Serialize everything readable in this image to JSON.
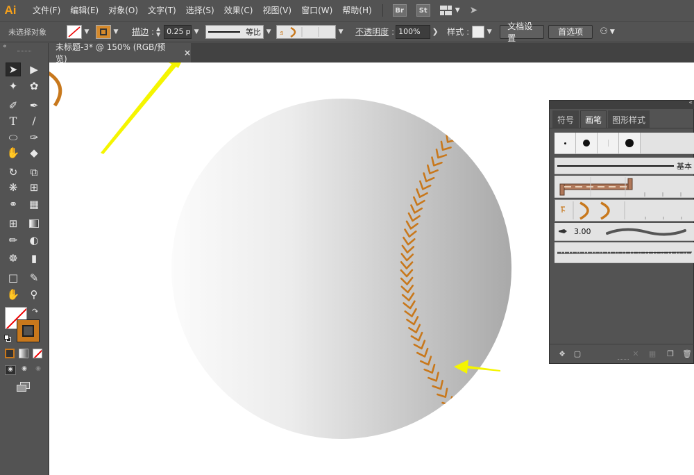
{
  "app": {
    "logo": "Ai",
    "menu": [
      "文件(F)",
      "编辑(E)",
      "对象(O)",
      "文字(T)",
      "选择(S)",
      "效果(C)",
      "视图(V)",
      "窗口(W)",
      "帮助(H)"
    ],
    "menu_icons": [
      "Br",
      "St"
    ]
  },
  "control_bar": {
    "selection_status": "未选择对象",
    "stroke_label": "描边",
    "stroke_value": "0.25",
    "stroke_unit": "p",
    "stroke_profile": "等比",
    "opacity_label": "不透明度",
    "opacity_value": "100%",
    "style_label": "样式",
    "doc_setup_button": "文档设置",
    "preferences_button": "首选项"
  },
  "document_tab": {
    "title": "未标题-3* @ 150% (RGB/预览)",
    "close_glyph": "×"
  },
  "brush_panel": {
    "tabs": [
      "符号",
      "画笔",
      "图形样式"
    ],
    "active_tab": "画笔",
    "basic_label": "基本",
    "bristle_size": "3.00"
  },
  "colors": {
    "accent_orange": "#c8781c",
    "ui_gray": "#535353",
    "annotation_yellow": "#f5f500"
  },
  "icons": {
    "tools": [
      "selection-tool-icon",
      "direct-selection-tool-icon",
      "magic-wand-icon",
      "lasso-icon",
      "pen-tool-icon",
      "curvature-tool-icon",
      "type-tool-icon",
      "line-tool-icon",
      "ellipse-tool-icon",
      "paintbrush-icon",
      "shaper-icon",
      "eraser-icon",
      "rotate-icon",
      "scale-icon",
      "warp-icon",
      "free-transform-icon",
      "shape-builder-icon",
      "perspective-icon",
      "mesh-icon",
      "gradient-icon",
      "eyedropper-icon",
      "blend-icon",
      "symbol-sprayer-icon",
      "graph-icon",
      "artboard-icon",
      "slice-icon",
      "hand-icon",
      "zoom-icon"
    ]
  }
}
